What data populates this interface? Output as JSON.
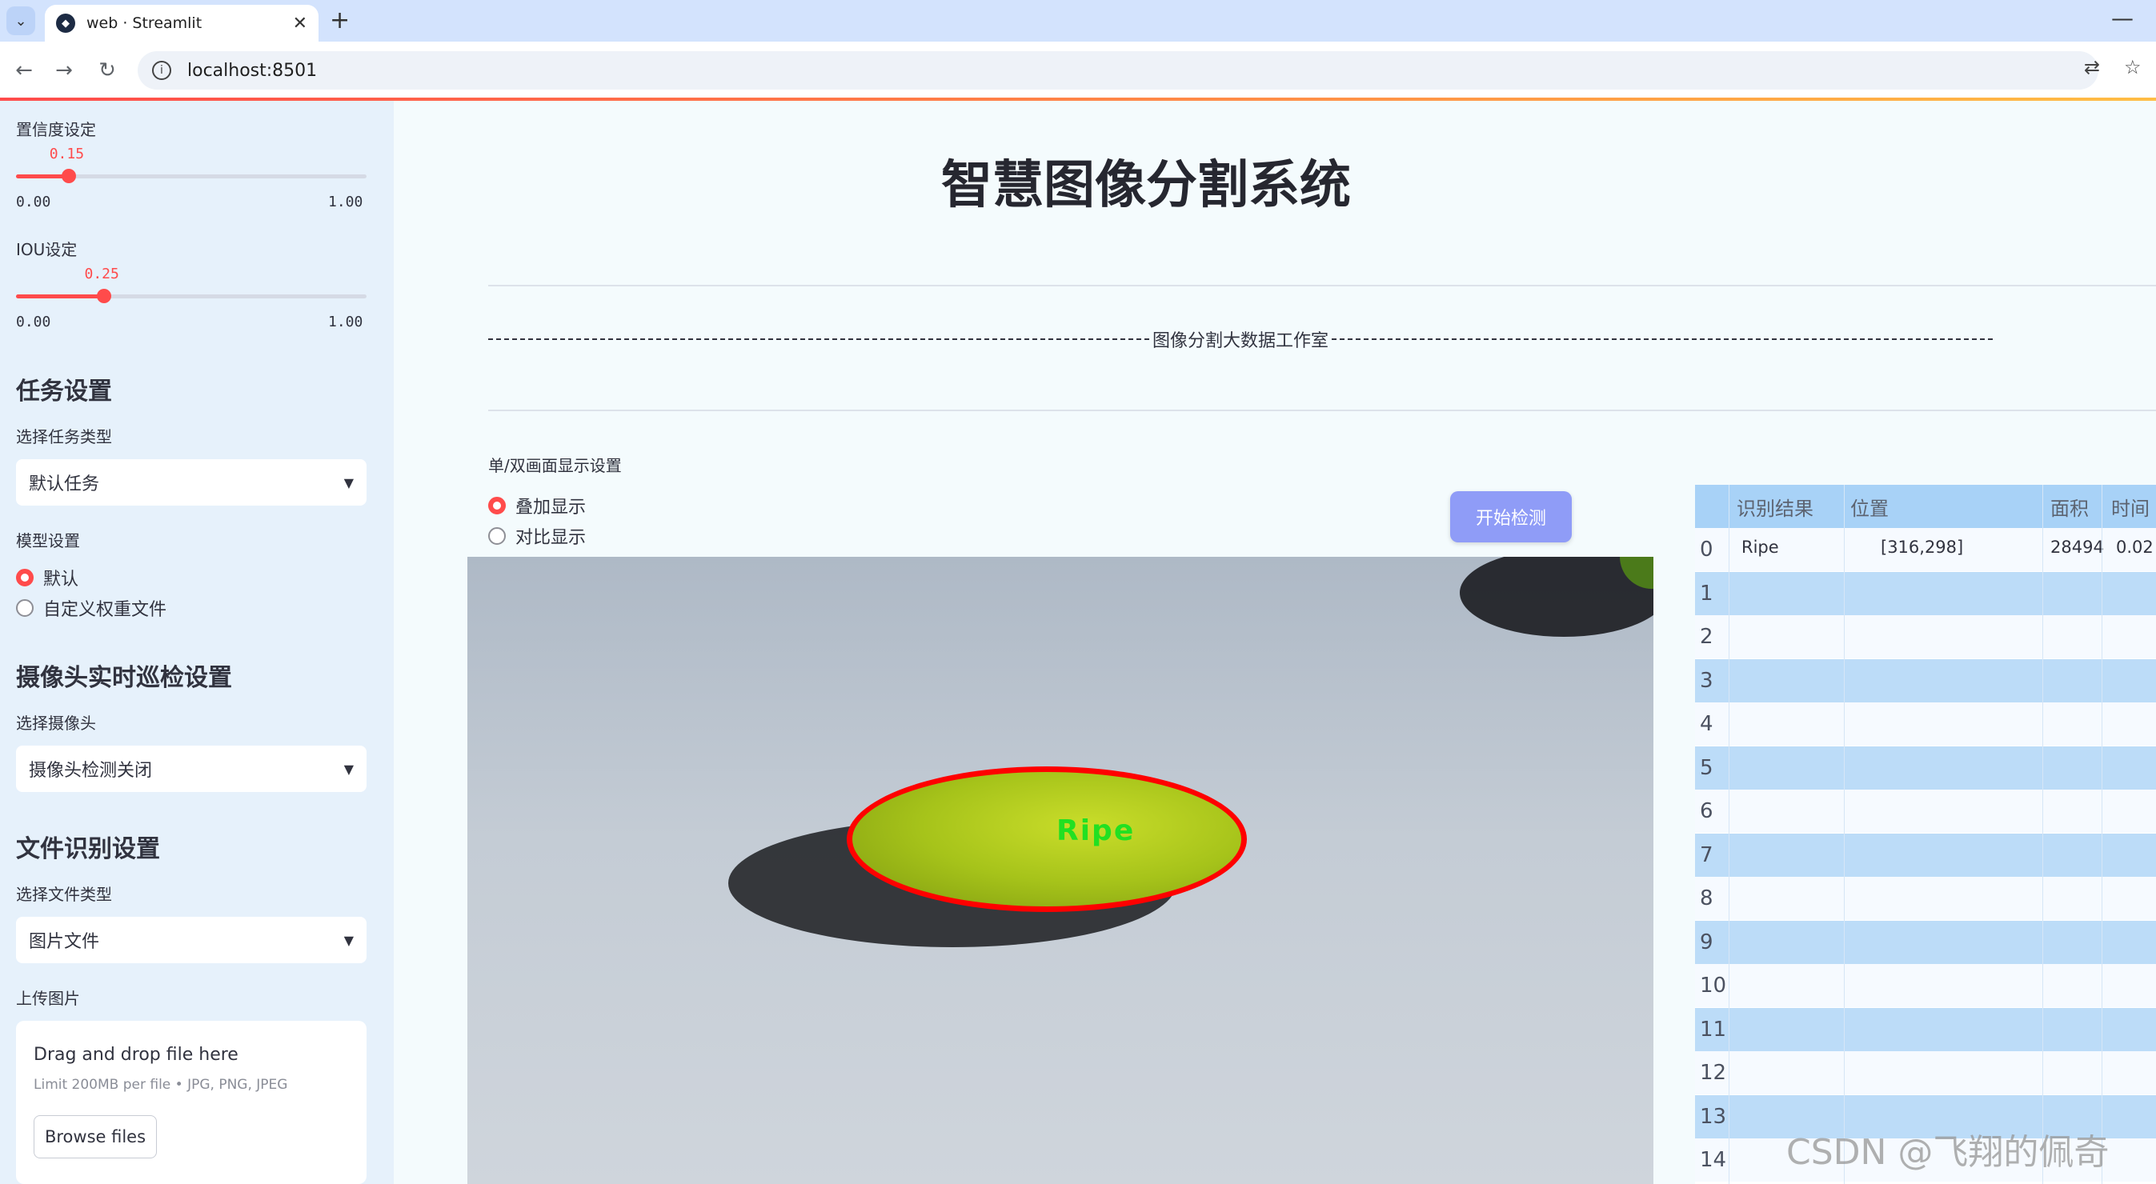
{
  "browser": {
    "tab_title": "web · Streamlit",
    "url": "localhost:8501"
  },
  "sidebar": {
    "confidence_label": "置信度设定",
    "confidence_value": "0.15",
    "confidence_fraction": 0.15,
    "confidence_min": "0.00",
    "confidence_max": "1.00",
    "iou_label": "IOU设定",
    "iou_value": "0.25",
    "iou_fraction": 0.25,
    "iou_min": "0.00",
    "iou_max": "1.00",
    "task_heading": "任务设置",
    "task_type_label": "选择任务类型",
    "task_type_value": "默认任务",
    "model_label": "模型设置",
    "model_options": [
      "默认",
      "自定义权重文件"
    ],
    "camera_heading": "摄像头实时巡检设置",
    "camera_label": "选择摄像头",
    "camera_value": "摄像头检测关闭",
    "file_heading": "文件识别设置",
    "file_type_label": "选择文件类型",
    "file_type_value": "图片文件",
    "upload_label": "上传图片",
    "upload_drop": "Drag and drop file here",
    "upload_limit": "Limit 200MB per file • JPG, PNG, JPEG",
    "upload_button": "Browse files"
  },
  "main": {
    "title": "智慧图像分割系统",
    "studio": "图像分割大数据工作室",
    "display_label": "单/双画面显示设置",
    "display_options": [
      "叠加显示",
      "对比显示"
    ],
    "start_button": "开始检测",
    "detection_label": "Ripe"
  },
  "table": {
    "columns": [
      "识别结果",
      "位置",
      "面积",
      "时间"
    ],
    "row_indices": [
      "0",
      "1",
      "2",
      "3",
      "4",
      "5",
      "6",
      "7",
      "8",
      "9",
      "10",
      "11",
      "12",
      "13",
      "14"
    ],
    "rows": [
      {
        "result": "Ripe",
        "position": "[316,298]",
        "area": "28494",
        "time": "0.02"
      }
    ]
  },
  "watermark": "CSDN @飞翔的佩奇",
  "colors": {
    "accent": "#ff4b4b",
    "button": "#8f9cf7",
    "table_header": "#a8d2f7",
    "sidebar_bg": "#e6f1fb"
  }
}
